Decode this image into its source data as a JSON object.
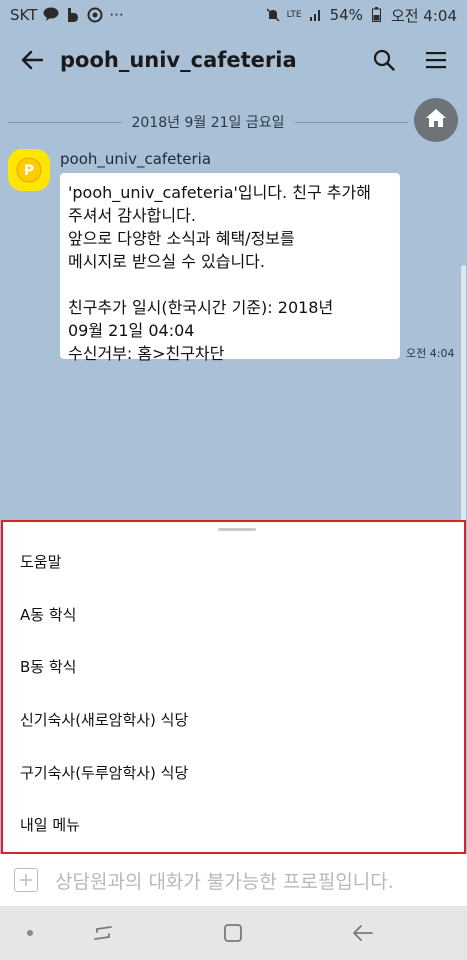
{
  "status_bar": {
    "carrier": "SKT",
    "lte": "LTE",
    "battery": "54%",
    "time": "오전 4:04",
    "more": "···"
  },
  "app_bar": {
    "title": "pooh_univ_cafeteria",
    "icons": [
      "back-arrow-icon",
      "search-icon",
      "menu-icon"
    ]
  },
  "chat": {
    "date_divider": "2018년 9월 21일 금요일",
    "sender": "pooh_univ_cafeteria",
    "message": "'pooh_univ_cafeteria'입니다. 친구 추가해\n주셔서 감사합니다.\n 앞으로 다양한 소식과 혜택/정보를\n메시지로 받으실 수 있습니다.\n\n친구추가 일시(한국시간 기준): 2018년\n09월 21일 04:04\n수신거부: 홈>친구차단",
    "message_time": "오전 4:04"
  },
  "quick_menu": {
    "items": [
      {
        "label": "도움말"
      },
      {
        "label": "A동 학식"
      },
      {
        "label": "B동 학식"
      },
      {
        "label": "신기숙사(새로암학사) 식당"
      },
      {
        "label": "구기숙사(두루암학사) 식당"
      },
      {
        "label": "내일 메뉴"
      }
    ]
  },
  "input_bar": {
    "placeholder": "상담원과의 대화가 불가능한 프로필입니다."
  },
  "colors": {
    "background": "#a9c0d6",
    "accent_border": "#d8232a",
    "avatar": "#ffe600"
  }
}
